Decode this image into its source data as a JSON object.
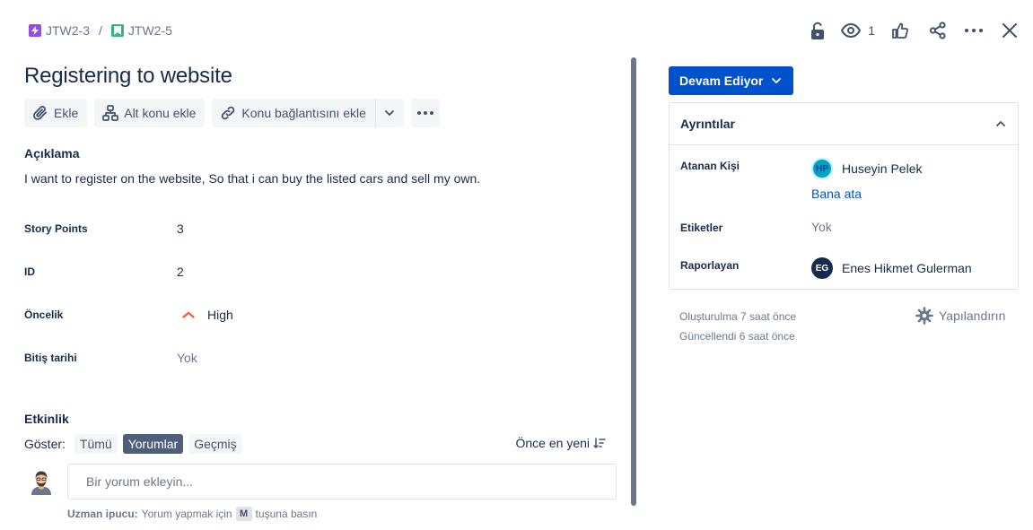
{
  "breadcrumb": {
    "parent_key": "JTW2-3",
    "separator": "/",
    "issue_key": "JTW2-5"
  },
  "header": {
    "watch_count": "1"
  },
  "issue": {
    "title": "Registering to website"
  },
  "toolbar": {
    "attach_label": "Ekle",
    "subtask_label": "Alt konu ekle",
    "link_label": "Konu bağlantısını ekle"
  },
  "description": {
    "heading": "Açıklama",
    "text": "I want to register on the website, So that i can buy the listed cars and sell my own."
  },
  "fields": {
    "story_points": {
      "label": "Story Points",
      "value": "3"
    },
    "id": {
      "label": "ID",
      "value": "2"
    },
    "priority": {
      "label": "Öncelik",
      "value": "High"
    },
    "due_date": {
      "label": "Bitiş tarihi",
      "value": "Yok"
    }
  },
  "activity": {
    "heading": "Etkinlik",
    "show_label": "Göster:",
    "filters": [
      "Tümü",
      "Yorumlar",
      "Geçmiş"
    ],
    "active_filter_index": 1,
    "sort_label": "Önce en yeni",
    "comment_placeholder": "Bir yorum ekleyin...",
    "tip_bold": "Uzman ipucu:",
    "tip_before": "Yorum yapmak için",
    "tip_key": "M",
    "tip_after": "tuşuna basın"
  },
  "sidebar": {
    "status_label": "Devam Ediyor",
    "details_heading": "Ayrıntılar",
    "assignee_label": "Atanan Kişi",
    "assignee_name": "Huseyin Pelek",
    "assignee_initials": "HP",
    "assign_to_me": "Bana ata",
    "labels_label": "Etiketler",
    "labels_value": "Yok",
    "reporter_label": "Raporlayan",
    "reporter_name": "Enes Hikmet Gulerman",
    "reporter_initials": "EG",
    "created": "Oluşturulma 7 saat önce",
    "updated": "Güncellendi 6 saat önce",
    "configure_label": "Yapılandırın"
  },
  "colors": {
    "primary": "#0052cc",
    "text": "#172b4d",
    "muted": "#6b778c",
    "priority_high": "#ff5630",
    "epic": "#904ee2",
    "story": "#36b37e"
  },
  "icons": [
    "epic-icon",
    "story-icon",
    "lock-icon",
    "eye-icon",
    "thumbs-up-icon",
    "share-icon",
    "more-icon",
    "close-icon",
    "paperclip-icon",
    "subtask-icon",
    "link-icon",
    "chevron-down-icon",
    "priority-high-icon",
    "sort-icon",
    "chevron-up-icon",
    "gear-icon"
  ]
}
